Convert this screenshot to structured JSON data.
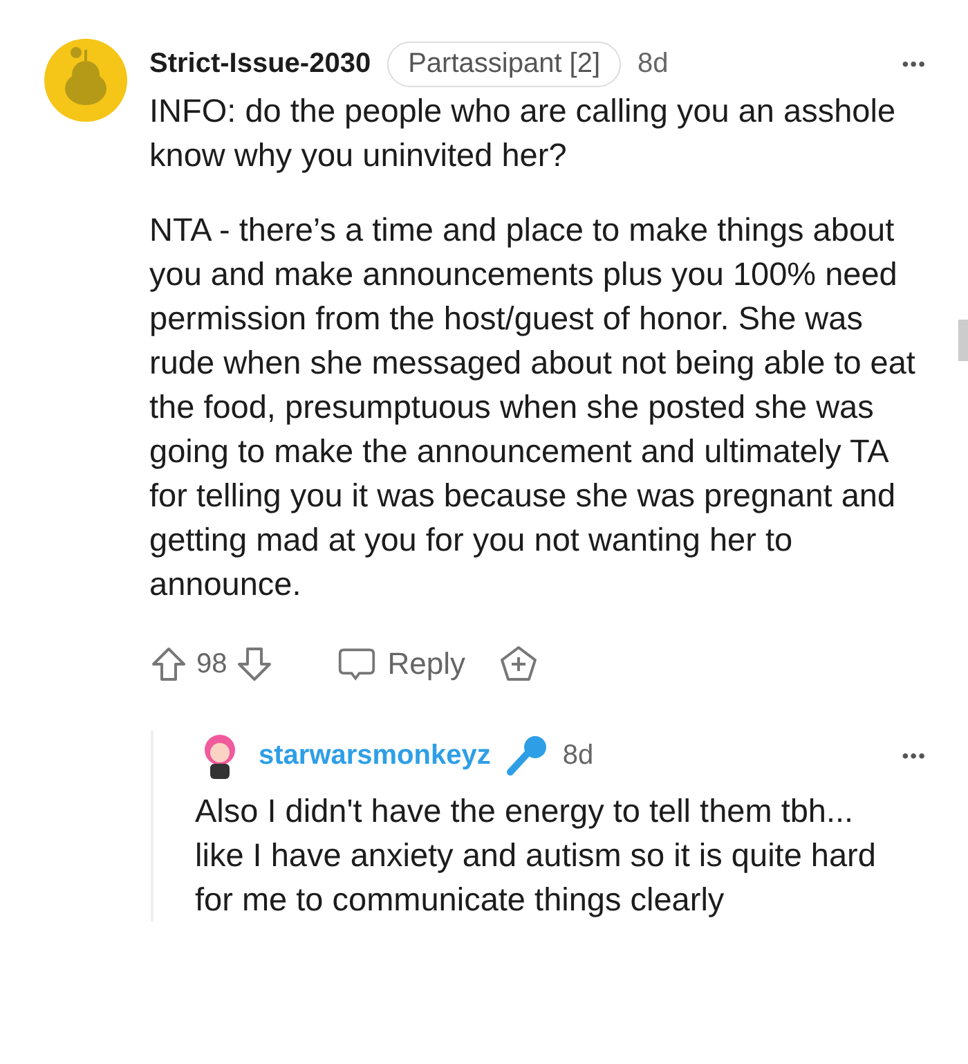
{
  "comment": {
    "author": "Strict-Issue-2030",
    "flair": "Partassipant [2]",
    "age": "8d",
    "more": "•••",
    "paragraphs": [
      "INFO: do the people who are calling you an asshole know why you uninvited her?",
      "NTA - there’s a time and place to make things about you and make announcements plus you 100% need permission from the host/guest of honor. She was rude when she messaged about not being able to eat the food, presumptuous when she posted she was going to make the announcement and ultimately TA for telling you it was because she was pregnant and getting mad at you for you not wanting her to announce."
    ],
    "score": "98",
    "reply_label": "Reply"
  },
  "reply": {
    "author": "starwarsmonkeyz",
    "age": "8d",
    "more": "•••",
    "paragraphs": [
      "Also I didn't have the energy to tell them tbh... like I have anxiety and autism so it is quite hard for me to communicate things clearly"
    ]
  }
}
